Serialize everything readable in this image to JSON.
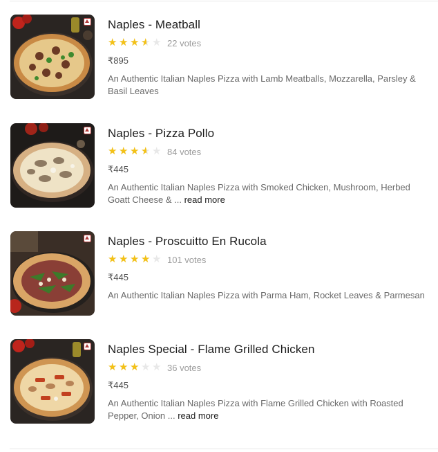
{
  "items": [
    {
      "name": "Naples - Meatball",
      "rating": 3.5,
      "votes": "22 votes",
      "price": "₹895",
      "description": "An Authentic Italian Naples Pizza with Lamb Meatballs, Mozzarella, Parsley & Basil Leaves",
      "read_more": ""
    },
    {
      "name": "Naples - Pizza Pollo",
      "rating": 3.5,
      "votes": "84 votes",
      "price": "₹445",
      "description": "An Authentic Italian Naples Pizza with Smoked Chicken, Mushroom, Herbed Goatt Cheese & ...",
      "read_more": "read more"
    },
    {
      "name": "Naples - Proscuitto En Rucola",
      "rating": 4,
      "votes": "101 votes",
      "price": "₹445",
      "description": "An Authentic Italian Naples Pizza with Parma Ham, Rocket Leaves & Parmesan",
      "read_more": ""
    },
    {
      "name": "Naples Special - Flame Grilled Chicken",
      "rating": 3,
      "votes": "36 votes",
      "price": "₹445",
      "description": "An Authentic Italian Naples Pizza with Flame Grilled Chicken with Roasted Pepper, Onion ...",
      "read_more": "read more"
    }
  ],
  "colors": {
    "star_filled": "#f3c117",
    "star_empty": "#e8e8e8",
    "veg_mark": "#b23b3b"
  }
}
